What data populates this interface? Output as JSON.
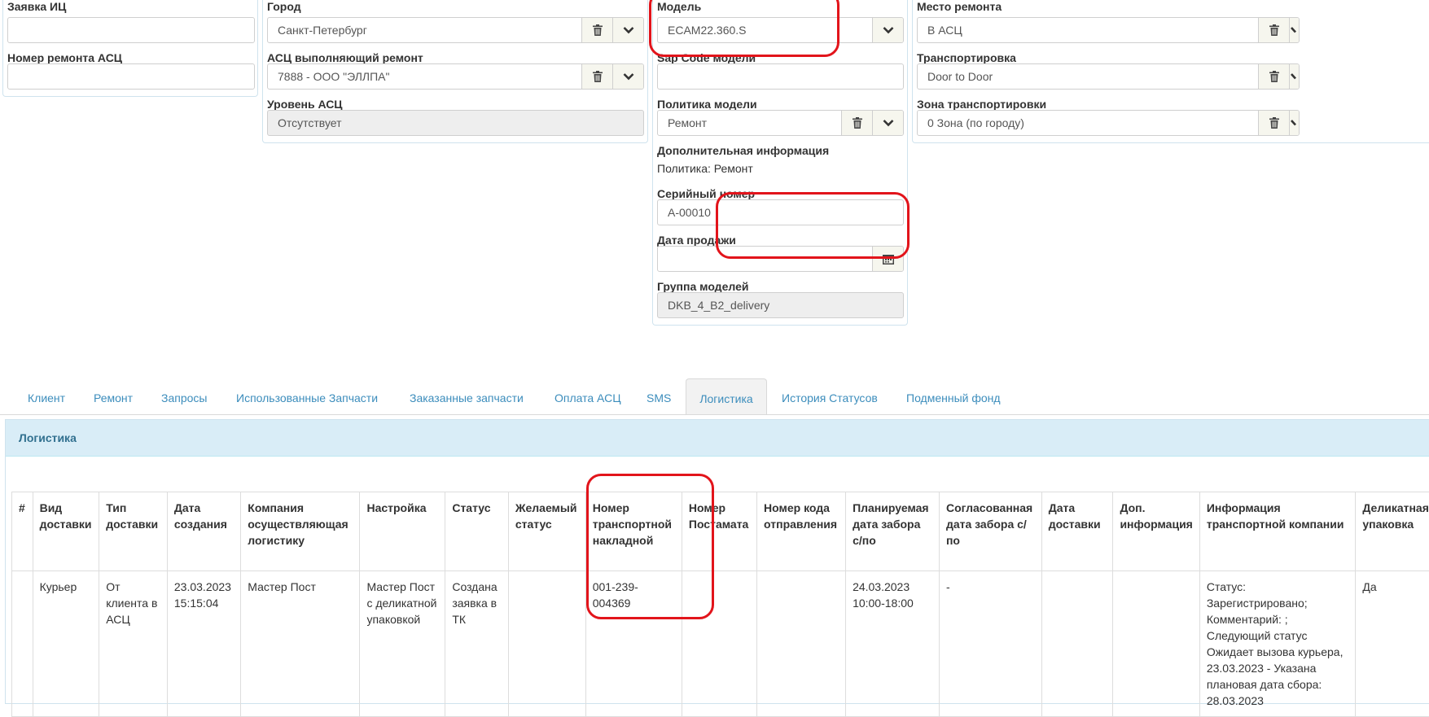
{
  "col1": {
    "label_request": "Заявка ИЦ",
    "value_request": "",
    "label_repair_no": "Номер ремонта АСЦ",
    "value_repair_no": ""
  },
  "col2": {
    "label_city": "Город",
    "value_city": "Санкт-Петербург",
    "label_asc": "АСЦ выполняющий ремонт",
    "value_asc": "7888 - ООО \"ЭЛЛПА\"",
    "label_level": "Уровень АСЦ",
    "value_level": "Отсутствует"
  },
  "col3": {
    "label_model": "Модель",
    "value_model": "ECAM22.360.S",
    "label_sap": "Sap Code модели",
    "value_sap": "",
    "label_policy": "Политика модели",
    "value_policy": "Ремонт",
    "label_extra": "Дополнительная информация",
    "value_extra": "Политика: Ремонт",
    "label_serial": "Серийный номер",
    "value_serial": "A-00010",
    "label_sale_date": "Дата продажи",
    "value_sale_date": "",
    "label_group": "Группа моделей",
    "value_group": "DKB_4_B2_delivery"
  },
  "col4": {
    "label_place": "Место ремонта",
    "value_place": "В АСЦ",
    "label_transport": "Транспортировка",
    "value_transport": "Door to Door",
    "label_zone": "Зона транспортировки",
    "value_zone": "0 Зона (по городу)"
  },
  "tabs": [
    {
      "label": "Клиент"
    },
    {
      "label": "Ремонт"
    },
    {
      "label": "Запросы"
    },
    {
      "label": "Использованные Запчасти"
    },
    {
      "label": "Заказанные запчасти"
    },
    {
      "label": "Оплата АСЦ"
    },
    {
      "label": "SMS"
    },
    {
      "label": "Логистика"
    },
    {
      "label": "История Статусов"
    },
    {
      "label": "Подменный фонд"
    }
  ],
  "active_tab": "Логистика",
  "logistics": {
    "title": "Логистика",
    "headers": [
      "#",
      "Вид доставки",
      "Тип доставки",
      "Дата создания",
      "Компания осуществляющая логистику",
      "Настройка",
      "Статус",
      "Желаемый статус",
      "Номер транспортной накладной",
      "Номер Постамата",
      "Номер кода отправления",
      "Планируемая дата забора с/по",
      "Согласованная дата забора с/по",
      "Дата доставки",
      "Доп. информация",
      "Информация транспортной компании",
      "Деликатная упаковка"
    ],
    "rows": [
      [
        "",
        "Курьер",
        "От клиента в АСЦ",
        "23.03.2023 15:15:04",
        "Мастер Пост",
        "Мастер Пост с деликатной упаковкой",
        "Создана заявка в ТК",
        "",
        "001-239-004369",
        "",
        "",
        "24.03.2023 10:00-18:00",
        "-",
        "",
        "",
        "Статус: Зарегистрировано; Комментарий: ; Следующий статус Ожидает вызова курьера, 23.03.2023 - Указана плановая дата сбора: 28.03.2023",
        "Да"
      ]
    ]
  },
  "colors": {
    "accent": "#3c8dbc",
    "panel_header_bg": "#d9edf7",
    "highlight": "#e2141b"
  }
}
